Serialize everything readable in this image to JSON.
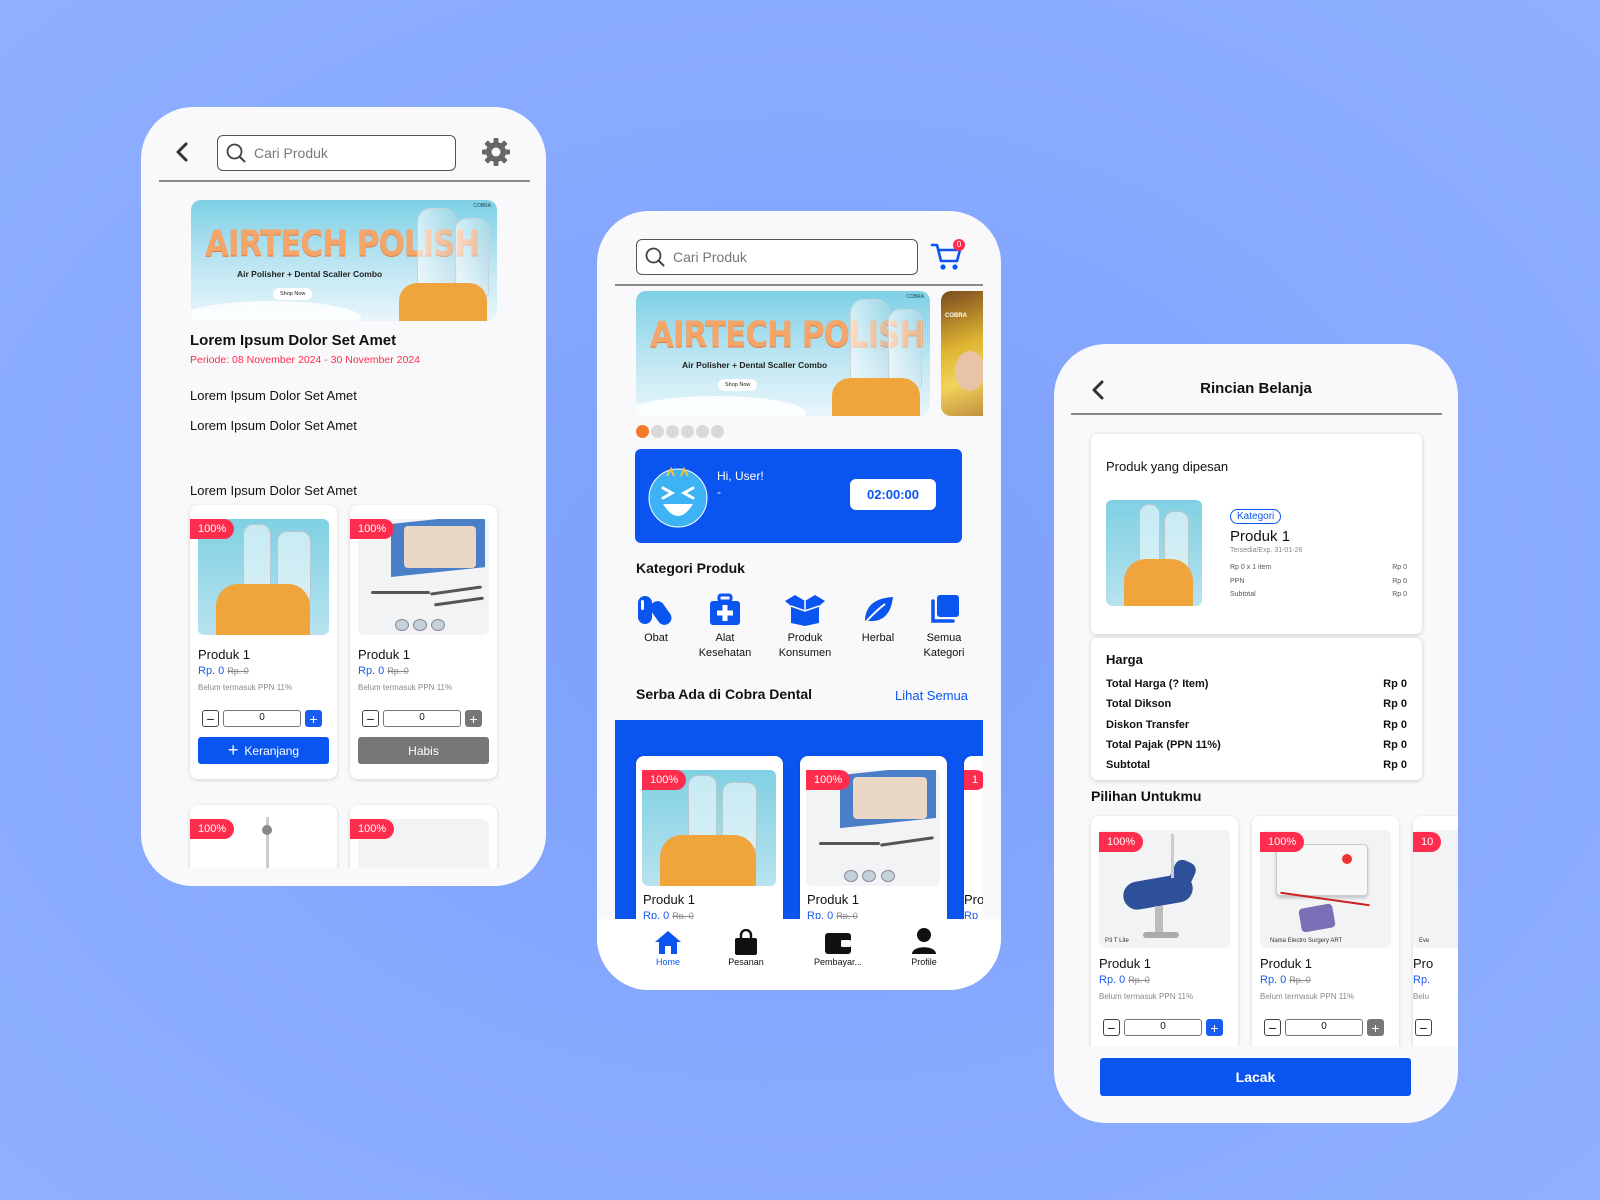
{
  "colors": {
    "background": "#88aaff",
    "primary": "#0a55f0",
    "badge": "#ff2d4d",
    "accent_orange": "#f47a2a"
  },
  "left": {
    "search_placeholder": "Cari Produk",
    "banner": {
      "title": "AIRTECH POLISH",
      "subtitle": "Air Polisher + Dental Scaller Combo",
      "button": "Shop Now",
      "brand": "COBRA"
    },
    "promo_title": "Lorem Ipsum Dolor Set Amet",
    "promo_period": "Periode: 08 November 2024 - 30 November 2024",
    "lines": [
      "Lorem Ipsum Dolor Set Amet",
      "Lorem Ipsum Dolor Set Amet",
      "Lorem Ipsum Dolor Set Amet"
    ],
    "products": [
      {
        "badge": "100%",
        "name": "Produk 1",
        "price": "Rp. 0",
        "old_price": "Rp. 0",
        "note": "Belum termasuk PPN 11%",
        "qty": "0",
        "button": "Keranjang",
        "available": true
      },
      {
        "badge": "100%",
        "name": "Produk 1",
        "price": "Rp. 0",
        "old_price": "Rp. 0",
        "note": "Belum termasuk PPN 11%",
        "qty": "0",
        "button": "Habis",
        "available": false
      }
    ],
    "products_row2_badges": [
      "100%",
      "100%"
    ]
  },
  "mid": {
    "search_placeholder": "Cari Produk",
    "cart_count": "0",
    "banner": {
      "title": "AIRTECH POLISH",
      "subtitle": "Air Polisher + Dental Scaller Combo",
      "button": "Shop Now",
      "brand": "COBRA"
    },
    "side_banner_brand": "COBRA",
    "greeting": "Hi, User!",
    "greeting_sub": "-",
    "timer": "02:00:00",
    "category_title": "Kategori Produk",
    "categories": [
      {
        "icon": "pill-icon",
        "label": "Obat"
      },
      {
        "icon": "medkit-icon",
        "label": "Alat Kesehatan"
      },
      {
        "icon": "box-icon",
        "label": "Produk Konsumen"
      },
      {
        "icon": "leaf-icon",
        "label": "Herbal"
      },
      {
        "icon": "stack-icon",
        "label": "Semua Kategori"
      }
    ],
    "section_title": "Serba Ada di Cobra Dental",
    "see_all": "Lihat Semua",
    "products": [
      {
        "badge": "100%",
        "name": "Produk 1",
        "price": "Rp. 0",
        "old_price": "Rp. 0"
      },
      {
        "badge": "100%",
        "name": "Produk 1",
        "price": "Rp. 0",
        "old_price": "Rp. 0"
      },
      {
        "badge": "1",
        "name": "Pro",
        "price": "Rp"
      }
    ],
    "nav": [
      {
        "icon": "home-icon",
        "label": "Home",
        "active": true
      },
      {
        "icon": "bag-icon",
        "label": "Pesanan",
        "active": false
      },
      {
        "icon": "wallet-icon",
        "label": "Pembayar...",
        "active": false
      },
      {
        "icon": "profile-icon",
        "label": "Profile",
        "active": false
      }
    ]
  },
  "right": {
    "title": "Rincian Belanja",
    "ordered_title": "Produk yang dipesan",
    "category_tag": "Kategori",
    "product_name": "Produk 1",
    "stock_exp": "Tersedia/Exp. 31-01-26",
    "mini_rows": [
      {
        "label": "Rp 0 x 1 item",
        "value": "Rp 0"
      },
      {
        "label": "PPN",
        "value": "Rp 0"
      },
      {
        "label": "Subtotal",
        "value": "Rp 0"
      }
    ],
    "price_title": "Harga",
    "summary": [
      {
        "label": "Total Harga (? Item)",
        "value": "Rp 0"
      },
      {
        "label": "Total Dikson",
        "value": "Rp 0"
      },
      {
        "label": "Diskon Transfer",
        "value": "Rp 0"
      },
      {
        "label": "Total Pajak (PPN 11%)",
        "value": "Rp 0"
      },
      {
        "label": "Subtotal",
        "value": "Rp 0"
      }
    ],
    "picks_title": "Pilihan Untukmu",
    "picks": [
      {
        "badge": "100%",
        "image_caption": "P3 T Lite",
        "name": "Produk 1",
        "price": "Rp. 0",
        "old_price": "Rp. 0",
        "note": "Belum termasuk PPN 11%",
        "qty": "0"
      },
      {
        "badge": "100%",
        "image_caption": "Nama Electro Surgery ART",
        "name": "Produk 1",
        "price": "Rp. 0",
        "old_price": "Rp. 0",
        "note": "Belum termasuk PPN 11%",
        "qty": "0"
      },
      {
        "badge": "10",
        "image_caption": "Eve",
        "name": "Pro",
        "price": "Rp.",
        "note": "Belu"
      }
    ],
    "track_button": "Lacak"
  }
}
